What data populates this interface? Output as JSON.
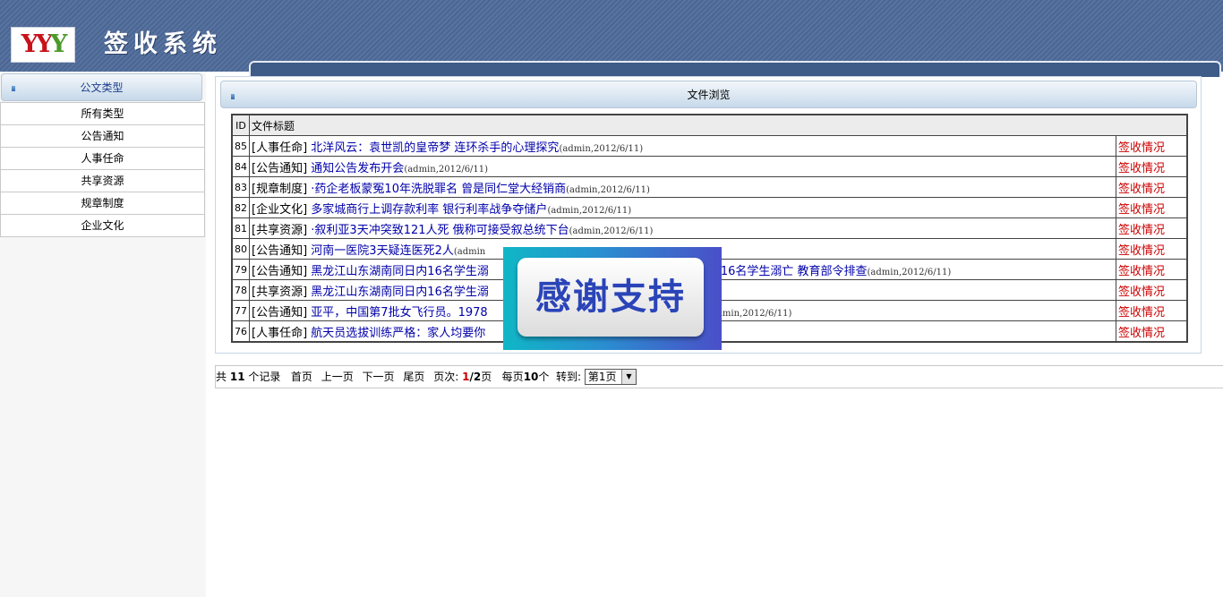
{
  "header": {
    "logo_text": "YYY",
    "app_title": "签收系统"
  },
  "sidebar": {
    "title": "公文类型",
    "items": [
      "所有类型",
      "公告通知",
      "人事任命",
      "共享资源",
      "规章制度",
      "企业文化"
    ]
  },
  "panel": {
    "title": "文件浏览",
    "columns": {
      "id": "ID",
      "title": "文件标题"
    },
    "rows": [
      {
        "id": "85",
        "category": "[人事任命]",
        "title": "北洋风云：袁世凯的皇帝梦 连环杀手的心理探究",
        "meta": "(admin,2012/6/11)",
        "action": "签收情况"
      },
      {
        "id": "84",
        "category": "[公告通知]",
        "title": "通知公告发布开会",
        "meta": "(admin,2012/6/11)",
        "action": "签收情况"
      },
      {
        "id": "83",
        "category": "[规章制度]",
        "title": "·药企老板蒙冤10年洗脱罪名 曾是同仁堂大经销商",
        "meta": "(admin,2012/6/11)",
        "action": "签收情况"
      },
      {
        "id": "82",
        "category": "[企业文化]",
        "title": "多家城商行上调存款利率 银行利率战争夺储户",
        "meta": "(admin,2012/6/11)",
        "action": "签收情况"
      },
      {
        "id": "81",
        "category": "[共享资源]",
        "title": "·叙利亚3天冲突致121人死 俄称可接受叙总统下台",
        "meta": "(admin,2012/6/11)",
        "action": "签收情况"
      },
      {
        "id": "80",
        "category": "[公告通知]",
        "title": "河南一医院3天疑连医死2人",
        "meta": "(admin",
        "action": "签收情况"
      },
      {
        "id": "79",
        "category": "[公告通知]",
        "title": "黑龙江山东湖南同日内16名学生溺",
        "title_tail": "内16名学生溺亡 教育部令排查",
        "meta": "(admin,2012/6/11)",
        "action": "签收情况"
      },
      {
        "id": "78",
        "category": "[共享资源]",
        "title": "黑龙江山东湖南同日内16名学生溺",
        "meta": "",
        "action": "签收情况"
      },
      {
        "id": "77",
        "category": "[公告通知]",
        "title": "亚平，中国第7批女飞行员。1978",
        "meta": "(admin,2012/6/11)",
        "action": "签收情况"
      },
      {
        "id": "76",
        "category": "[人事任命]",
        "title": "航天员选拔训练严格：家人均要你",
        "meta": "",
        "action": "签收情况"
      }
    ]
  },
  "pager": {
    "total_prefix": "共",
    "total": "11",
    "total_suffix": "个记录",
    "first": "首页",
    "prev": "上一页",
    "next": "下一页",
    "last": "尾页",
    "page_label": "页次:",
    "current": "1",
    "slash": "/",
    "pages": "2",
    "page_suffix": "页",
    "per_label": "每页",
    "per": "10",
    "per_suffix": "个",
    "goto_label": "转到:",
    "select_value": "第1页"
  },
  "popup": {
    "text": "感谢支持"
  },
  "colors": {
    "header_bg": "#4f6c9b",
    "link": "#0000aa",
    "action": "#cc0000"
  }
}
